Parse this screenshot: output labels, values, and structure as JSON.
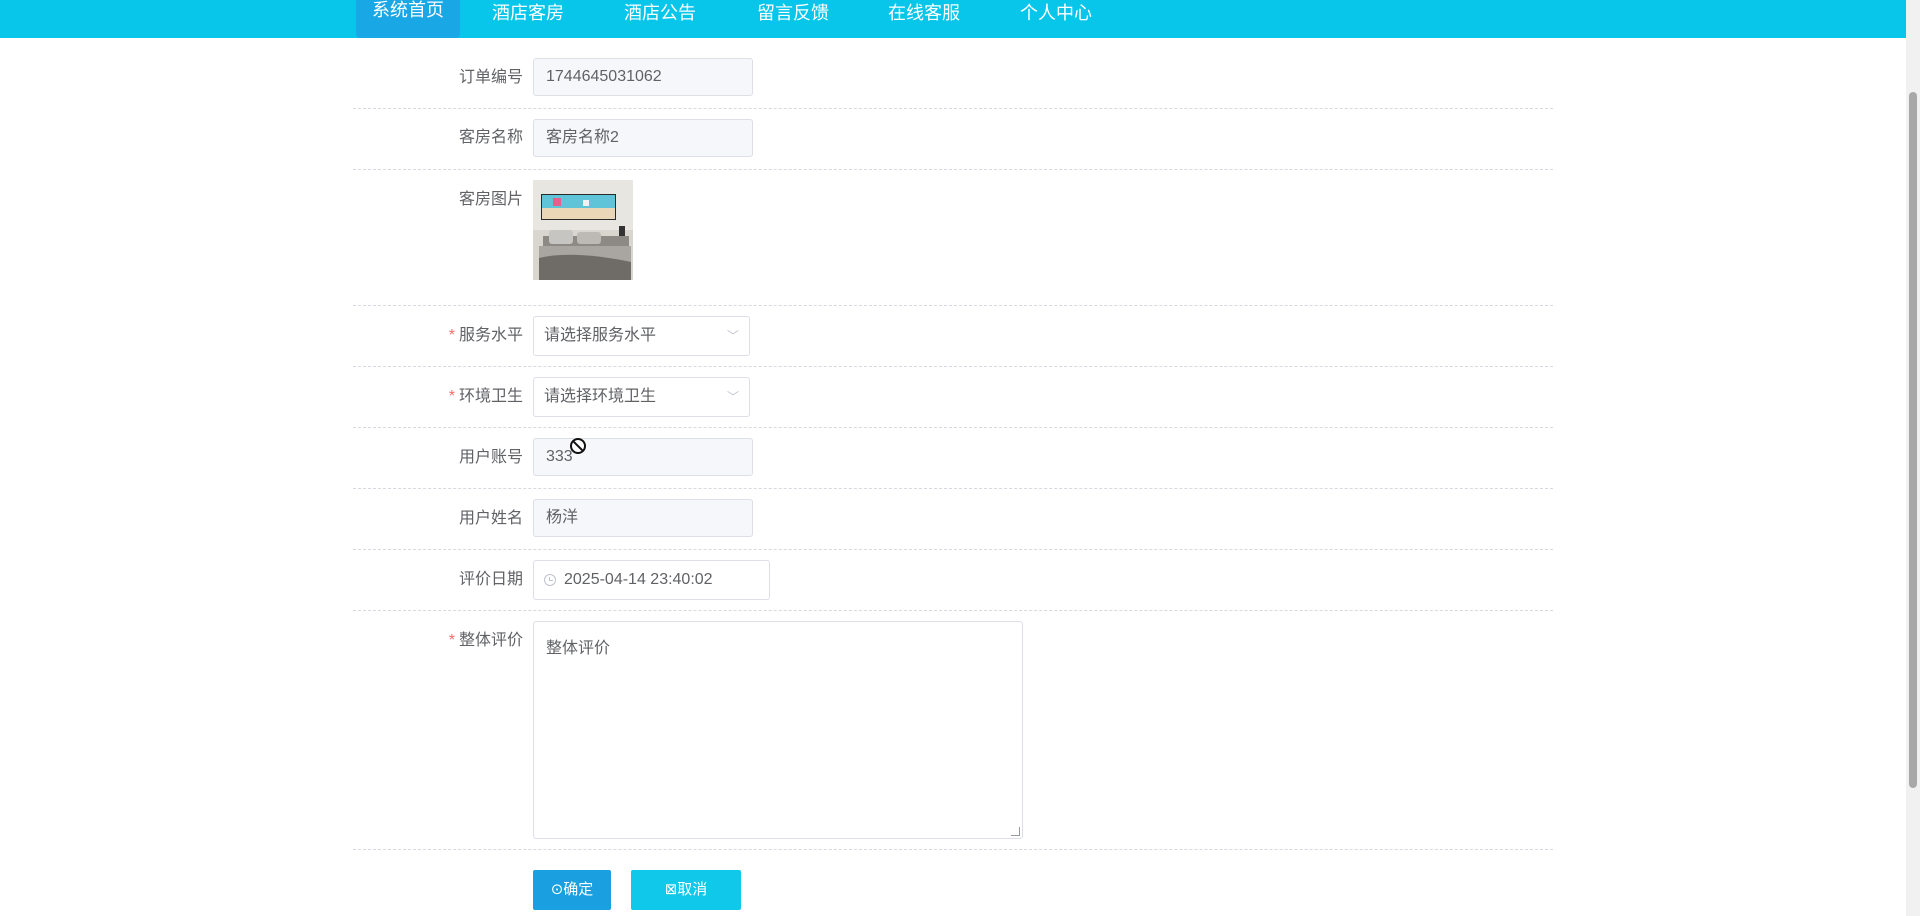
{
  "nav": {
    "items": [
      {
        "label": "系统首页",
        "active": true
      },
      {
        "label": "酒店客房"
      },
      {
        "label": "酒店公告"
      },
      {
        "label": "留言反馈"
      },
      {
        "label": "在线客服"
      },
      {
        "label": "个人中心"
      }
    ]
  },
  "form": {
    "order_no": {
      "label": "订单编号",
      "value": "1744645031062"
    },
    "room_name": {
      "label": "客房名称",
      "value": "客房名称2"
    },
    "room_image": {
      "label": "客房图片"
    },
    "service_level": {
      "label": "服务水平",
      "placeholder": "请选择服务水平"
    },
    "hygiene": {
      "label": "环境卫生",
      "placeholder": "请选择环境卫生"
    },
    "user_account": {
      "label": "用户账号",
      "value": "333"
    },
    "user_name": {
      "label": "用户姓名",
      "value": "杨洋"
    },
    "review_date": {
      "label": "评价日期",
      "value": "2025-04-14 23:40:02"
    },
    "overall": {
      "label": "整体评价",
      "placeholder": "整体评价"
    },
    "required_mark": "*"
  },
  "buttons": {
    "confirm": "⊙确定",
    "cancel": "⊠取消"
  },
  "colors": {
    "nav_bg": "#08c6ea",
    "nav_active": "#1aa7e6",
    "confirm_bg": "#1a9fe0",
    "cancel_bg": "#10c8ea",
    "required": "#f56c6c"
  }
}
